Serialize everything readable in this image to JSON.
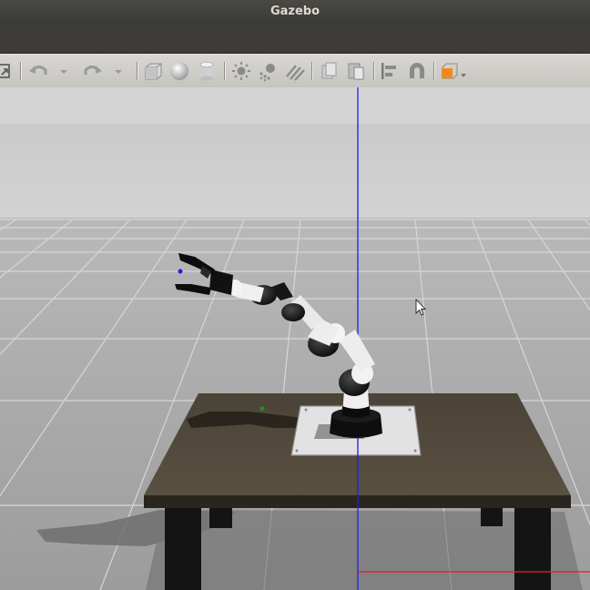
{
  "window": {
    "title": "Gazebo"
  },
  "toolbar": {
    "items": [
      "select-mode-icon",
      "undo-icon",
      "undo-history-icon",
      "redo-icon",
      "redo-history-icon",
      "box-shape-icon",
      "sphere-shape-icon",
      "cylinder-shape-icon",
      "point-light-icon",
      "spot-light-icon",
      "directional-light-icon",
      "copy-icon",
      "paste-icon",
      "align-icon",
      "snap-icon",
      "view-angle-icon"
    ]
  },
  "colors": {
    "sky": "#cfcfcf",
    "ground": "#a9a9a9",
    "table_top": "#4e4539",
    "table_legs": "#141414",
    "z_axis": "#1e1ee6",
    "x_axis": "#e62020",
    "accent_orange": "#f08a1c"
  }
}
